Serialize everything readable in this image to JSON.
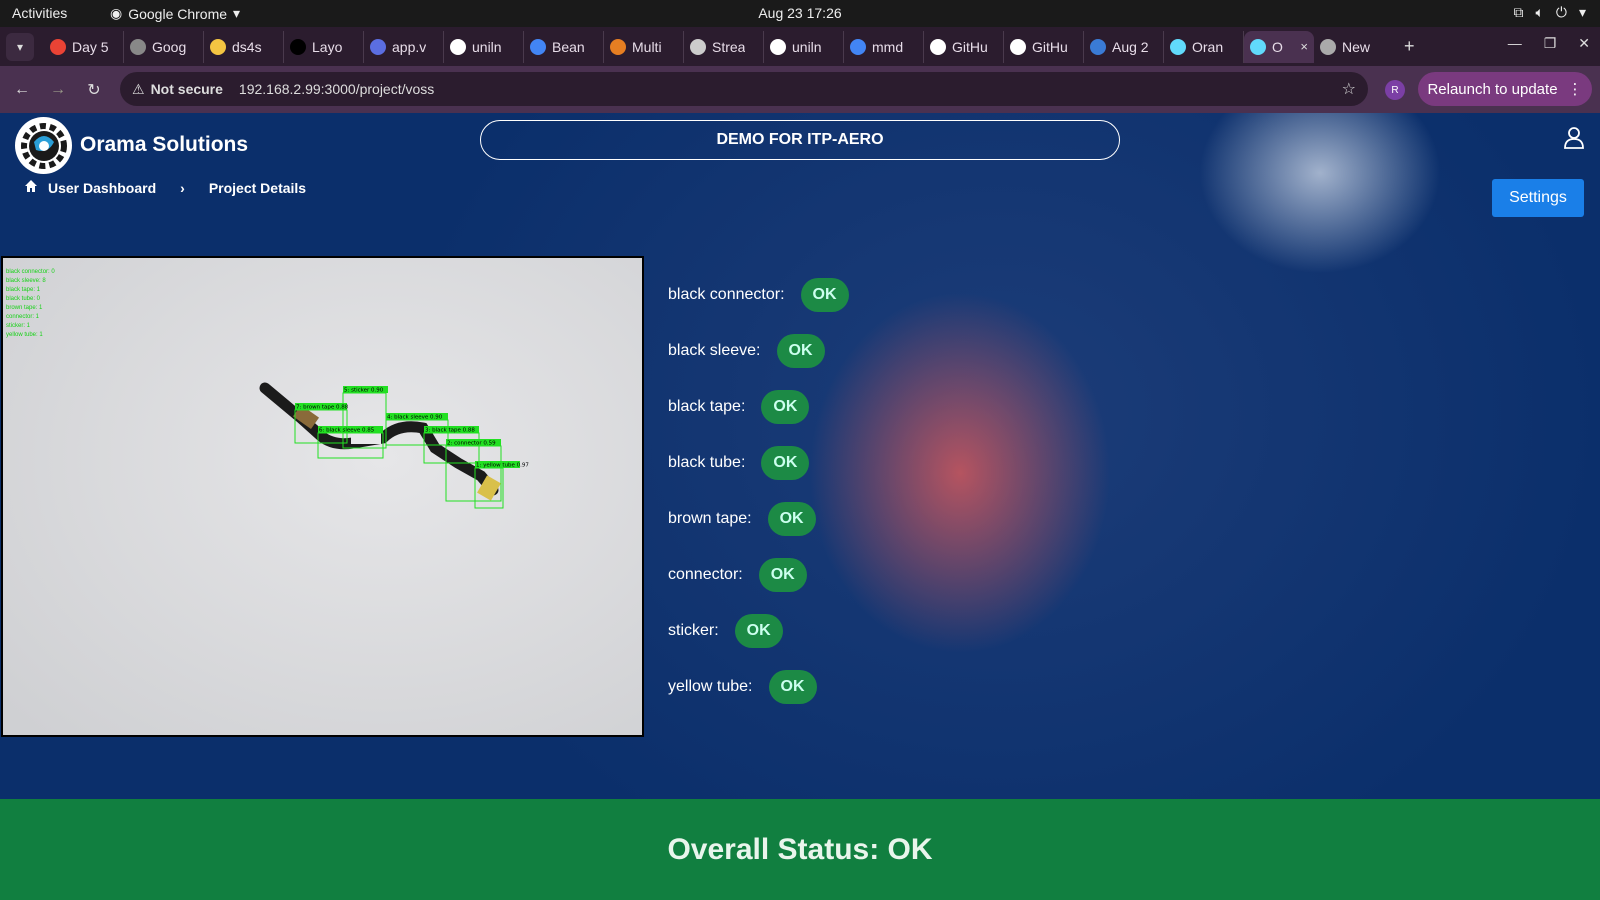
{
  "topbar": {
    "activities": "Activities",
    "app": "Google Chrome",
    "datetime": "Aug 23  17:26"
  },
  "tabs": [
    {
      "label": "Day 5",
      "icon": "gmail-icon",
      "color": "#ea4335"
    },
    {
      "label": "Goog",
      "icon": "chrome-icon",
      "color": "#888888"
    },
    {
      "label": "ds4s",
      "icon": "hf-icon",
      "color": "#f4c542"
    },
    {
      "label": "Layo",
      "icon": "medium-icon",
      "color": "#000000"
    },
    {
      "label": "app.v",
      "icon": "app-icon",
      "color": "#5b6ee1"
    },
    {
      "label": "uniln",
      "icon": "github-icon",
      "color": "#ffffff"
    },
    {
      "label": "Bean",
      "icon": "google-icon",
      "color": "#4285f4"
    },
    {
      "label": "Multi",
      "icon": "multi-icon",
      "color": "#e67e22"
    },
    {
      "label": "Strea",
      "icon": "openai-icon",
      "color": "#cccccc"
    },
    {
      "label": "uniln",
      "icon": "github-icon",
      "color": "#ffffff"
    },
    {
      "label": "mmd",
      "icon": "google-icon",
      "color": "#4285f4"
    },
    {
      "label": "GitHu",
      "icon": "github-icon",
      "color": "#ffffff"
    },
    {
      "label": "GitHu",
      "icon": "github-icon",
      "color": "#ffffff"
    },
    {
      "label": "Aug 2",
      "icon": "vs-icon",
      "color": "#3a7bd5"
    },
    {
      "label": "Oran",
      "icon": "react-icon",
      "color": "#61dafb"
    }
  ],
  "active_tab": {
    "label": "O",
    "close": "×"
  },
  "new_tab_label": "New",
  "addressbar": {
    "security": "Not secure",
    "url": "192.168.2.99:3000/project/voss",
    "profile_initial": "R",
    "relaunch": "Relaunch to update"
  },
  "header": {
    "brand": "Orama Solutions",
    "project": "DEMO FOR ITP-AERO"
  },
  "breadcrumb": {
    "home": "User Dashboard",
    "current": "Project Details"
  },
  "settings_label": "Settings",
  "camera": {
    "legend": [
      "black connector: 0",
      "black sleeve: 8",
      "black tape: 1",
      "black tube: 0",
      "brown tape: 1",
      "connector: 1",
      "sticker: 1",
      "yellow tube: 1"
    ],
    "detections": [
      {
        "label": "5: sticker 0.90"
      },
      {
        "label": "7: brown tape 0.88"
      },
      {
        "label": "6: black sleeve 0.85"
      },
      {
        "label": "4: black sleeve 0.90"
      },
      {
        "label": "3: black tape 0.88"
      },
      {
        "label": "2: connector 0.59"
      },
      {
        "label": "1: yellow tube 0.97"
      }
    ]
  },
  "results": [
    {
      "label": "black connector:",
      "status": "OK"
    },
    {
      "label": "black sleeve:",
      "status": "OK"
    },
    {
      "label": "black tape:",
      "status": "OK"
    },
    {
      "label": "black tube:",
      "status": "OK"
    },
    {
      "label": "brown tape:",
      "status": "OK"
    },
    {
      "label": "connector:",
      "status": "OK"
    },
    {
      "label": "sticker:",
      "status": "OK"
    },
    {
      "label": "yellow tube:",
      "status": "OK"
    }
  ],
  "overall": "Overall Status: OK"
}
